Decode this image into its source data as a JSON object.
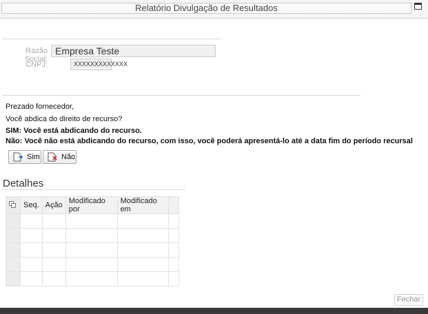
{
  "window": {
    "title": "Relatório Divulgação de Resultados"
  },
  "company": {
    "razao_label": "Razão Social:",
    "razao_value": "Empresa Teste",
    "cnpj_label": "CNPJ:",
    "cnpj_value": "XXXXXXXXXXXXX"
  },
  "message": {
    "greeting": "Prezado fornecedor,",
    "question": "Você abdica do direito de recurso?",
    "sim_text": "SIM: Você está abdicando do recurso.",
    "nao_text": "Não: Você não está abdicando do recurso, com isso, você poderá apresentá-lo até a data fim do período recursal"
  },
  "buttons": {
    "sim": "Sim",
    "nao": "Não",
    "fechar": "Fechar"
  },
  "details": {
    "title": "Detalhes",
    "columns": [
      "Seq.",
      "Ação",
      "Modificado por",
      "Modificado em"
    ],
    "rows": [
      [
        "",
        "",
        "",
        ""
      ],
      [
        "",
        "",
        "",
        ""
      ],
      [
        "",
        "",
        "",
        ""
      ],
      [
        "",
        "",
        "",
        ""
      ],
      [
        "",
        "",
        "",
        ""
      ]
    ]
  },
  "icons": [
    "maximize-icon",
    "sim-document-icon",
    "nao-document-icon",
    "select-all-icon"
  ]
}
